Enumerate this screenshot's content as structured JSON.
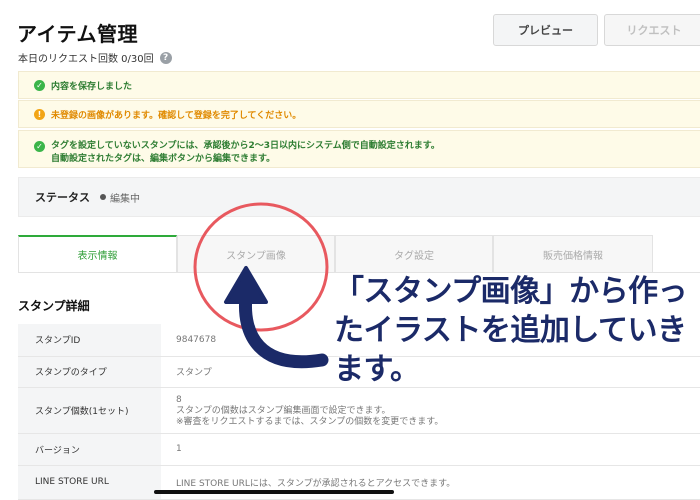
{
  "header": {
    "title": "アイテム管理",
    "quota_label": "本日のリクエスト回数 0/30回",
    "help_icon": "?",
    "preview_button": "プレビュー",
    "request_button": "リクエスト"
  },
  "alerts": [
    {
      "type": "success",
      "icon": "check-circle-icon",
      "text": "内容を保存しました"
    },
    {
      "type": "warning",
      "icon": "exclamation-circle-icon",
      "text": "未登録の画像があります。確認して登録を完了してください。"
    },
    {
      "type": "success",
      "icon": "check-circle-icon",
      "line1": "タグを設定していないスタンプには、承認後から2〜3日以内にシステム側で自動設定されます。",
      "line2": "自動設定されたタグは、編集ボタンから編集できます。"
    }
  ],
  "status": {
    "label": "ステータス",
    "value": "編集中"
  },
  "tabs": [
    {
      "label": "表示情報",
      "active": true
    },
    {
      "label": "スタンプ画像",
      "active": false
    },
    {
      "label": "タグ設定",
      "active": false
    },
    {
      "label": "販売価格情報",
      "active": false
    }
  ],
  "section": {
    "title": "スタンプ詳細"
  },
  "details": {
    "id": {
      "label": "スタンプID",
      "value": "9847678"
    },
    "type": {
      "label": "スタンプのタイプ",
      "value": "スタンプ"
    },
    "count": {
      "label": "スタンプ個数(1セット)",
      "value": "8",
      "note1": "スタンプの個数はスタンプ編集画面で設定できます。",
      "note2": "※審査をリクエストするまでは、スタンプの個数を変更できます。"
    },
    "version": {
      "label": "バージョン",
      "value": "1"
    },
    "store_url": {
      "label": "LINE STORE URL",
      "value": "LINE STORE URLには、スタンプが承認されるとアクセスできます。"
    }
  },
  "annotation": {
    "caption": "「スタンプ画像」から作ったイラストを追加していきます。",
    "circle_color": "#e8595f",
    "arrow_color": "#1b2a68"
  },
  "colors": {
    "accent_green": "#2eaa3a",
    "warning_orange": "#f2a516",
    "alert_bg": "#fefbe8"
  }
}
